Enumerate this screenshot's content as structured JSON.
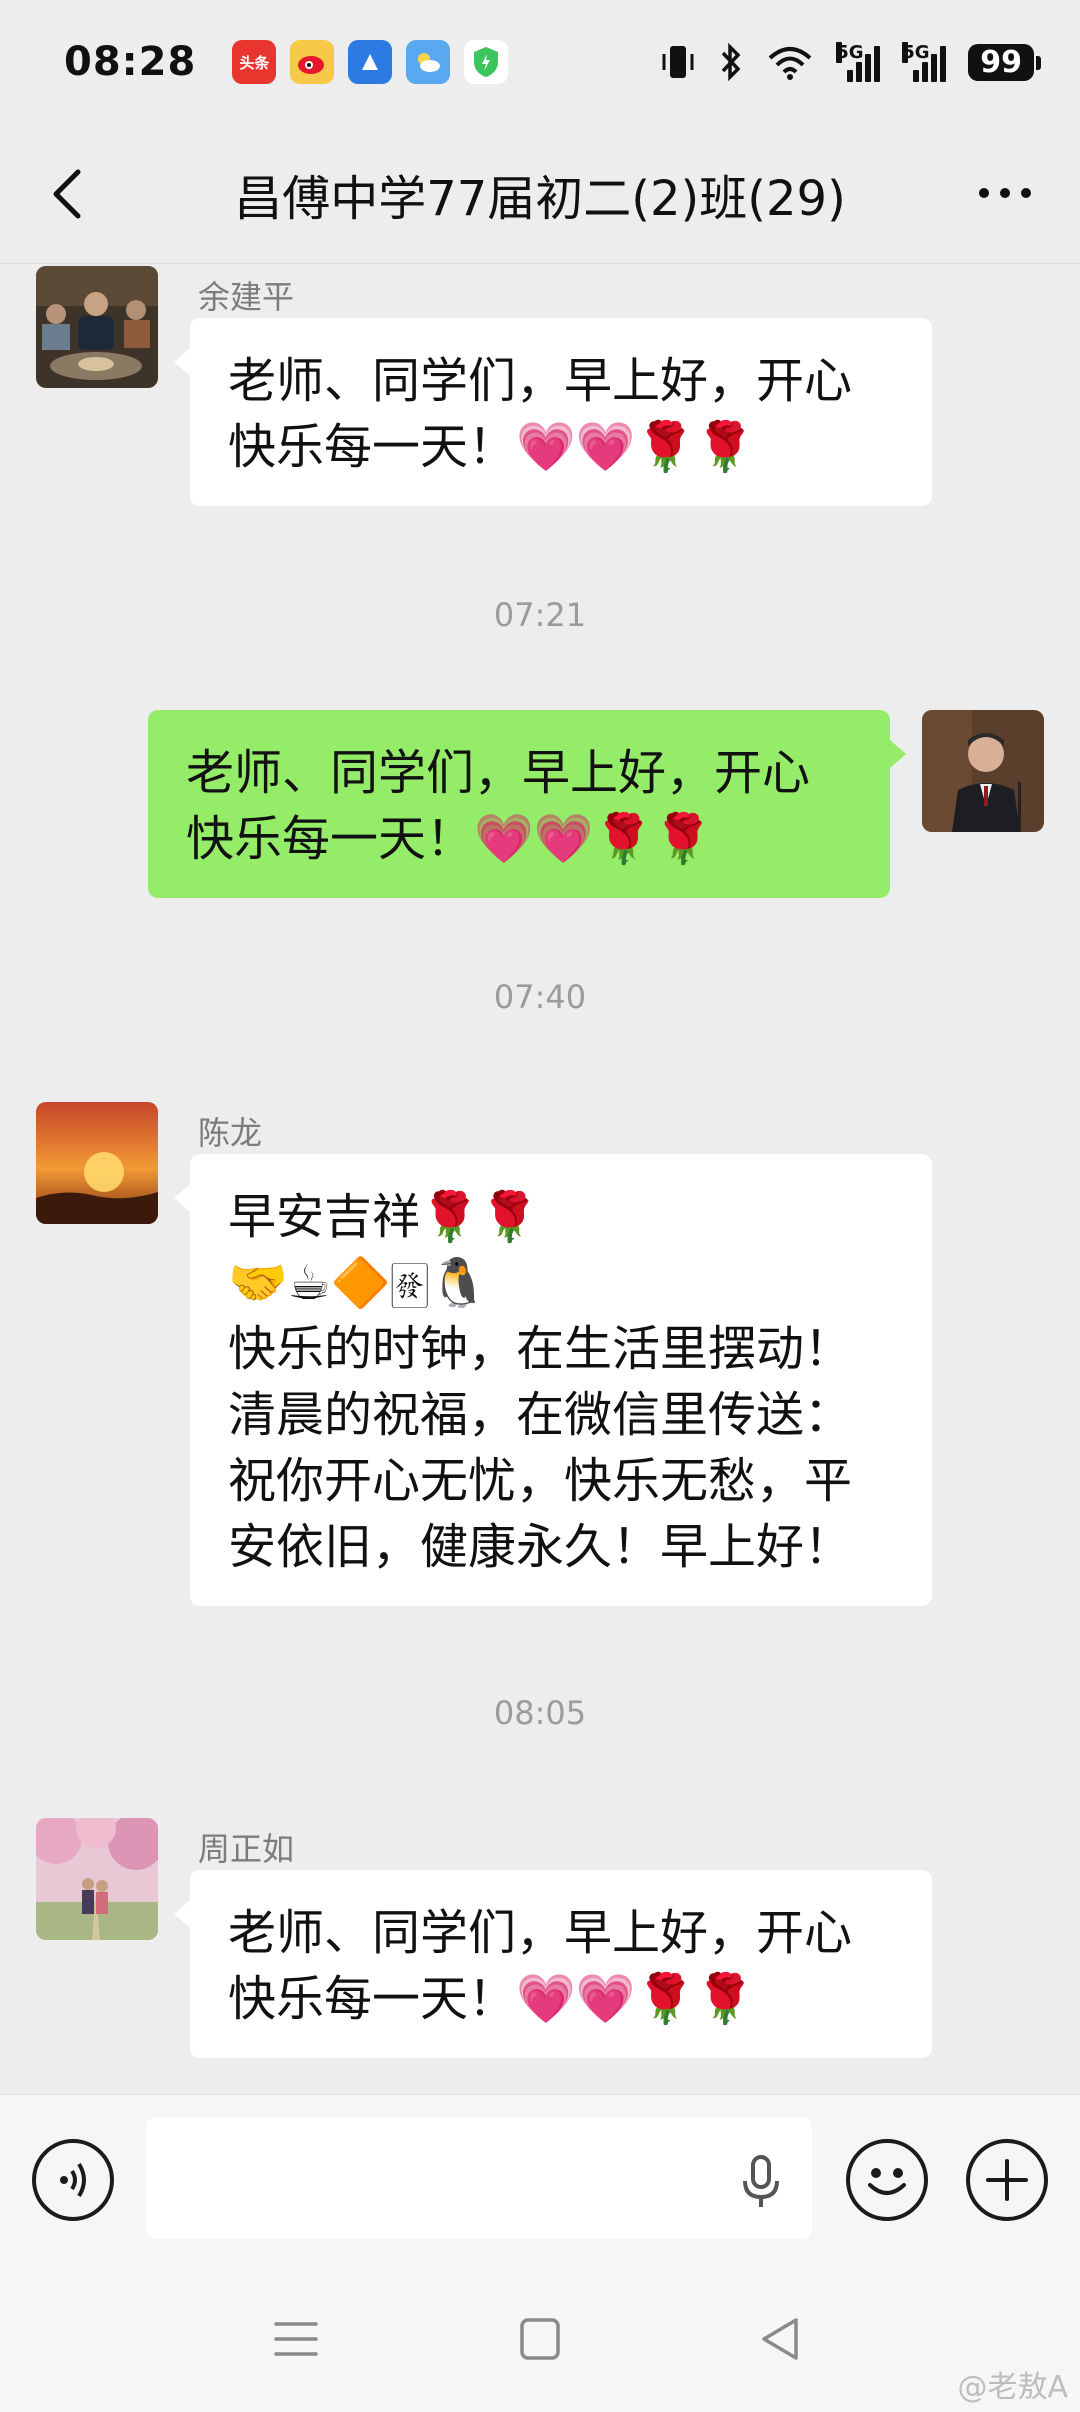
{
  "status_bar": {
    "time": "08:28",
    "app_icons": [
      {
        "name": "toutiao-icon",
        "label": "头条",
        "color": "#e8352e"
      },
      {
        "name": "weibo-icon",
        "label": "",
        "color": "#f7c948"
      },
      {
        "name": "browser-icon",
        "label": "",
        "color": "#2c7be5"
      },
      {
        "name": "weather-icon",
        "label": "",
        "color": "#5aa9f0"
      },
      {
        "name": "security-shield-icon",
        "label": "",
        "color": "#3cc45d"
      }
    ],
    "network_1": "5G",
    "network_2": "5G",
    "battery": "99"
  },
  "header": {
    "title": "昌傅中学77届初二(2)班(29)"
  },
  "messages": [
    {
      "type": "incoming",
      "sender": "余建平",
      "text": "老师、同学们，早上好，开心\n快乐每一天！💗💗🌹🌹"
    },
    {
      "type": "time",
      "text": "07:21"
    },
    {
      "type": "outgoing",
      "text": "老师、同学们，早上好，开心\n快乐每一天！💗💗🌹🌹"
    },
    {
      "type": "time",
      "text": "07:40"
    },
    {
      "type": "incoming",
      "sender": "陈龙",
      "text": "早安吉祥🌹🌹\n🤝☕🔶🀅🐧\n快乐的时钟，在生活里摆动！\n清晨的祝福，在微信里传送：\n祝你开心无忧，快乐无愁，平\n安依旧，健康永久！早上好！"
    },
    {
      "type": "time",
      "text": "08:05"
    },
    {
      "type": "incoming",
      "sender": "周正如",
      "text": "老师、同学们，早上好，开心\n快乐每一天！💗💗🌹🌹"
    }
  ],
  "watermark": "@老敖A"
}
